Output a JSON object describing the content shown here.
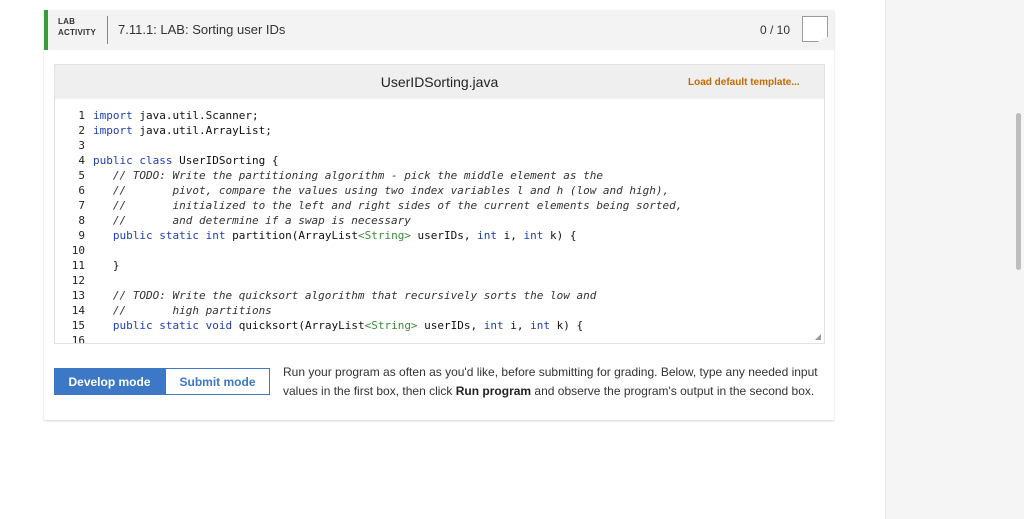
{
  "lab": {
    "tag_line1": "LAB",
    "tag_line2": "ACTIVITY",
    "title": "7.11.1: LAB: Sorting user IDs",
    "score": "0 / 10"
  },
  "editor": {
    "filename": "UserIDSorting.java",
    "load_default_label": "Load default template...",
    "line_numbers": [
      "1",
      "2",
      "3",
      "4",
      "5",
      "6",
      "7",
      "8",
      "9",
      "10",
      "11",
      "12",
      "13",
      "14",
      "15",
      "16"
    ],
    "code": {
      "l1": [
        "import",
        " java.util.Scanner;"
      ],
      "l2": [
        "import",
        " java.util.ArrayList;"
      ],
      "l4": [
        "public",
        " ",
        "class",
        " UserIDSorting {"
      ],
      "l5": "   // TODO: Write the partitioning algorithm - pick the middle element as the",
      "l6": "   //       pivot, compare the values using two index variables l and h (low and high),",
      "l7": "   //       initialized to the left and right sides of the current elements being sorted,",
      "l8": "   //       and determine if a swap is necessary",
      "l9": [
        "   ",
        "public",
        " ",
        "static",
        " ",
        "int",
        " partition(ArrayList",
        "<String>",
        " userIDs, ",
        "int",
        " i, ",
        "int",
        " k) {"
      ],
      "l11": "   }",
      "l13": "   // TODO: Write the quicksort algorithm that recursively sorts the low and",
      "l14": "   //       high partitions",
      "l15": [
        "   ",
        "public",
        " ",
        "static",
        " ",
        "void",
        " quicksort(ArrayList",
        "<String>",
        " userIDs, ",
        "int",
        " i, ",
        "int",
        " k) {"
      ]
    }
  },
  "modes": {
    "develop_label": "Develop mode",
    "submit_label": "Submit mode",
    "active": "develop"
  },
  "instructions": {
    "part1": "Run your program as often as you'd like, before submitting for grading. Below, type any needed input values in the first box, then click ",
    "bold": "Run program",
    "part2": " and observe the program's output in the second box."
  },
  "colors": {
    "accent_green": "#3c9a3e",
    "accent_blue": "#3d78c7",
    "load_orange": "#c46a00"
  }
}
